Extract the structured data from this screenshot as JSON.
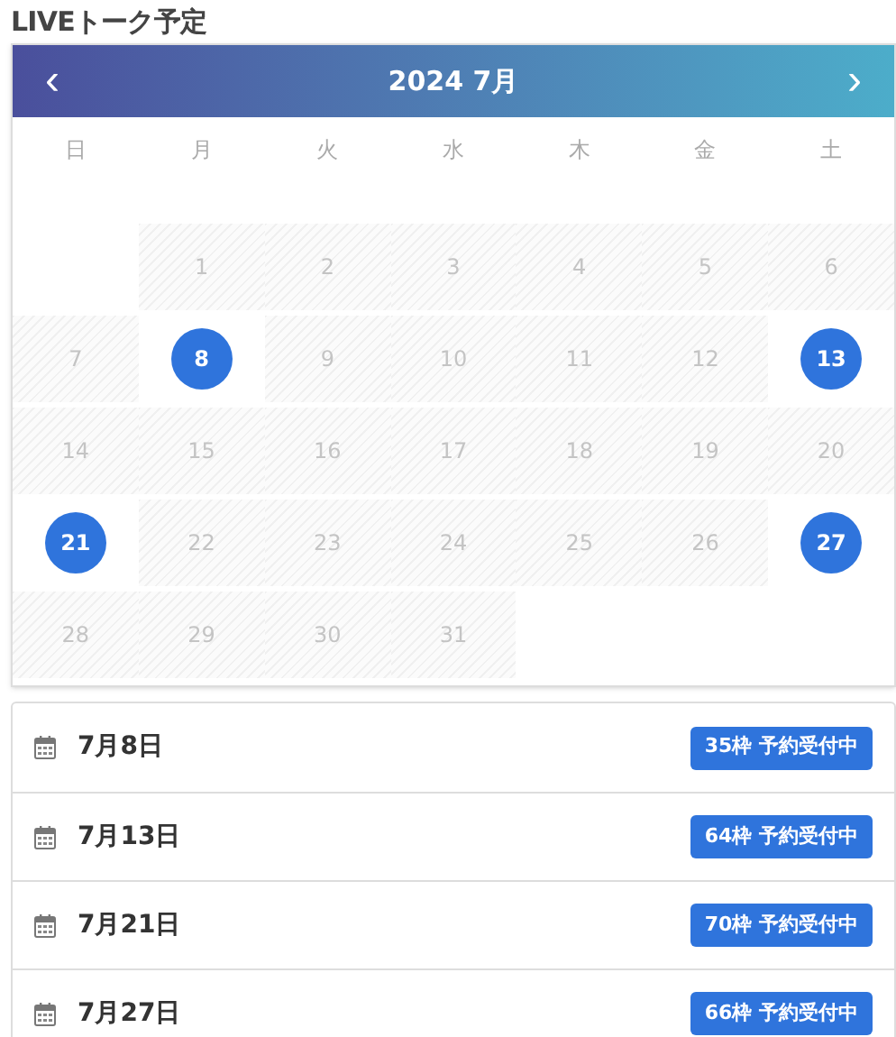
{
  "title": "LIVEトーク予定",
  "calendar": {
    "month_label": "2024 7月",
    "prev": "‹",
    "next": "›",
    "weekdays": [
      "日",
      "月",
      "火",
      "水",
      "木",
      "金",
      "土"
    ],
    "weeks": [
      [
        {
          "kind": "empty"
        },
        {
          "kind": "day",
          "day": "1",
          "available": false
        },
        {
          "kind": "day",
          "day": "2",
          "available": false
        },
        {
          "kind": "day",
          "day": "3",
          "available": false
        },
        {
          "kind": "day",
          "day": "4",
          "available": false
        },
        {
          "kind": "day",
          "day": "5",
          "available": false
        },
        {
          "kind": "day",
          "day": "6",
          "available": false
        }
      ],
      [
        {
          "kind": "day",
          "day": "7",
          "available": false
        },
        {
          "kind": "day",
          "day": "8",
          "available": true
        },
        {
          "kind": "day",
          "day": "9",
          "available": false
        },
        {
          "kind": "day",
          "day": "10",
          "available": false
        },
        {
          "kind": "day",
          "day": "11",
          "available": false
        },
        {
          "kind": "day",
          "day": "12",
          "available": false
        },
        {
          "kind": "day",
          "day": "13",
          "available": true
        }
      ],
      [
        {
          "kind": "day",
          "day": "14",
          "available": false
        },
        {
          "kind": "day",
          "day": "15",
          "available": false
        },
        {
          "kind": "day",
          "day": "16",
          "available": false
        },
        {
          "kind": "day",
          "day": "17",
          "available": false
        },
        {
          "kind": "day",
          "day": "18",
          "available": false
        },
        {
          "kind": "day",
          "day": "19",
          "available": false
        },
        {
          "kind": "day",
          "day": "20",
          "available": false
        }
      ],
      [
        {
          "kind": "day",
          "day": "21",
          "available": true
        },
        {
          "kind": "day",
          "day": "22",
          "available": false
        },
        {
          "kind": "day",
          "day": "23",
          "available": false
        },
        {
          "kind": "day",
          "day": "24",
          "available": false
        },
        {
          "kind": "day",
          "day": "25",
          "available": false
        },
        {
          "kind": "day",
          "day": "26",
          "available": false
        },
        {
          "kind": "day",
          "day": "27",
          "available": true
        }
      ],
      [
        {
          "kind": "day",
          "day": "28",
          "available": false
        },
        {
          "kind": "day",
          "day": "29",
          "available": false
        },
        {
          "kind": "day",
          "day": "30",
          "available": false
        },
        {
          "kind": "day",
          "day": "31",
          "available": false
        },
        {
          "kind": "empty"
        },
        {
          "kind": "empty"
        },
        {
          "kind": "empty"
        }
      ]
    ]
  },
  "schedule": [
    {
      "date": "7月8日",
      "badge": "35枠 予約受付中"
    },
    {
      "date": "7月13日",
      "badge": "64枠 予約受付中"
    },
    {
      "date": "7月21日",
      "badge": "70枠 予約受付中"
    },
    {
      "date": "7月27日",
      "badge": "66枠 予約受付中"
    }
  ]
}
